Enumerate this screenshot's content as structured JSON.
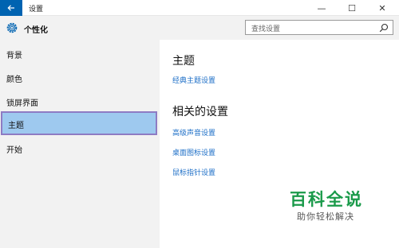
{
  "window": {
    "title": "设置",
    "back_icon": "arrow-left-icon",
    "minimize_glyph": "—",
    "maximize_glyph": "☐",
    "close_glyph": "✕"
  },
  "header": {
    "title": "个性化",
    "icon": "gear-icon"
  },
  "search": {
    "placeholder": "查找设置"
  },
  "sidebar": {
    "items": [
      {
        "label": "背景",
        "selected": false
      },
      {
        "label": "颜色",
        "selected": false
      },
      {
        "label": "锁屏界面",
        "selected": false
      },
      {
        "label": "主题",
        "selected": true
      },
      {
        "label": "开始",
        "selected": false
      }
    ]
  },
  "main": {
    "section1_title": "主题",
    "classic_theme_link": "经典主题设置",
    "section2_title": "相关的设置",
    "related_links": [
      "高级声音设置",
      "桌面图标设置",
      "鼠标指针设置"
    ]
  },
  "watermark": {
    "brand": "百科全说",
    "tagline": "助你轻松解决"
  },
  "colors": {
    "accent": "#0063b1",
    "selected_bg": "#9ec9ef",
    "link": "#1e6fc7",
    "watermark_green": "#1a9a4a"
  }
}
